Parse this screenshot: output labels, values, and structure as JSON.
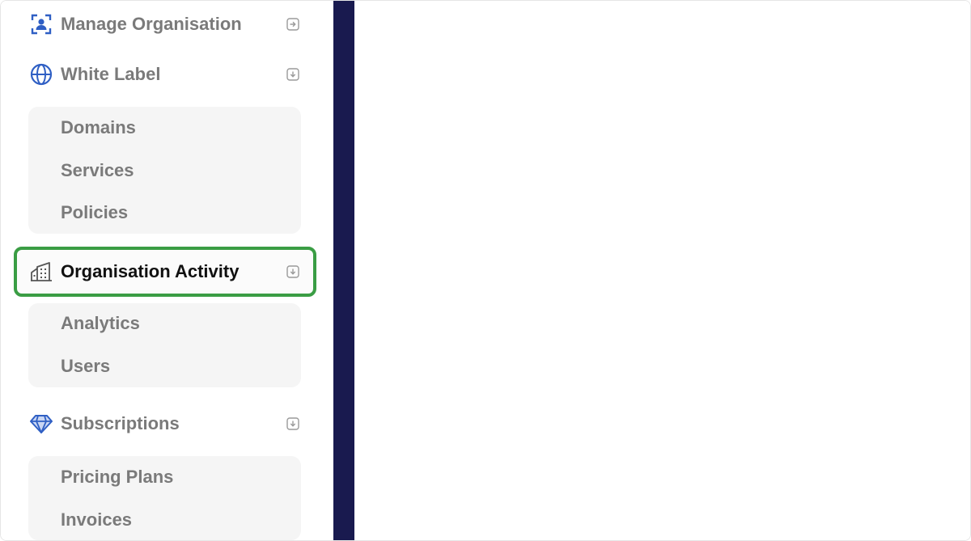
{
  "sidebar": {
    "items": [
      {
        "label": "Manage Organisation",
        "icon": "user-frame-icon",
        "chevron": "arrow-right-icon"
      },
      {
        "label": "White Label",
        "icon": "globe-icon",
        "chevron": "arrow-down-icon",
        "children": [
          "Domains",
          "Services",
          "Policies"
        ]
      },
      {
        "label": "Organisation Activity",
        "icon": "building-icon",
        "chevron": "arrow-down-icon",
        "children": [
          "Analytics",
          "Users"
        ]
      },
      {
        "label": "Subscriptions",
        "icon": "diamond-icon",
        "chevron": "arrow-down-icon",
        "children": [
          "Pricing Plans",
          "Invoices"
        ]
      }
    ],
    "active_item": "Organisation Activity"
  },
  "colors": {
    "accent_blue": "#2f5fc4",
    "active_border": "#3a9d44",
    "divider": "#191a4f",
    "submenu_bg": "#f5f5f5",
    "text_muted": "#7a7a7a"
  }
}
